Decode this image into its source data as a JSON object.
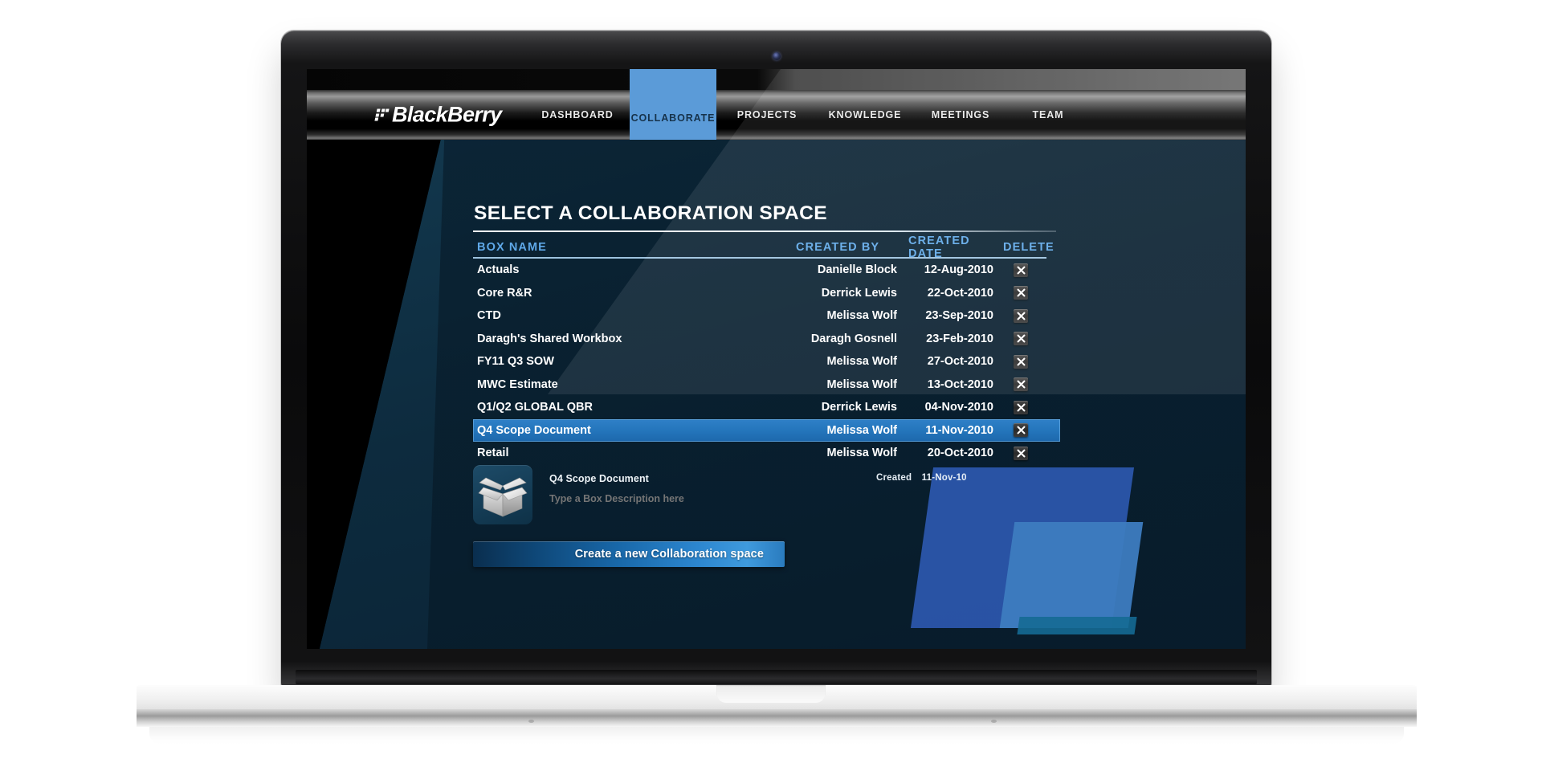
{
  "brand": {
    "name": "BlackBerry"
  },
  "nav": {
    "items": [
      {
        "label": "DASHBOARD",
        "active": false
      },
      {
        "label": "COLLABORATE",
        "active": true
      },
      {
        "label": "PROJECTS",
        "active": false
      },
      {
        "label": "KNOWLEDGE",
        "active": false
      },
      {
        "label": "MEETINGS",
        "active": false
      },
      {
        "label": "TEAM",
        "active": false
      }
    ]
  },
  "page": {
    "title": "SELECT A COLLABORATION SPACE"
  },
  "table": {
    "columns": [
      "BOX NAME",
      "CREATED BY",
      "CREATED DATE",
      "DELETE"
    ],
    "rows": [
      {
        "name": "Actuals",
        "created_by": "Danielle Block",
        "created_date": "12-Aug-2010",
        "selected": false
      },
      {
        "name": "Core R&R",
        "created_by": "Derrick Lewis",
        "created_date": "22-Oct-2010",
        "selected": false
      },
      {
        "name": "CTD",
        "created_by": "Melissa Wolf",
        "created_date": "23-Sep-2010",
        "selected": false
      },
      {
        "name": "Daragh's Shared Workbox",
        "created_by": "Daragh Gosnell",
        "created_date": "23-Feb-2010",
        "selected": false
      },
      {
        "name": "FY11 Q3 SOW",
        "created_by": "Melissa Wolf",
        "created_date": "27-Oct-2010",
        "selected": false
      },
      {
        "name": "MWC Estimate",
        "created_by": "Melissa Wolf",
        "created_date": "13-Oct-2010",
        "selected": false
      },
      {
        "name": "Q1/Q2 GLOBAL QBR",
        "created_by": "Derrick Lewis",
        "created_date": "04-Nov-2010",
        "selected": false
      },
      {
        "name": "Q4 Scope Document",
        "created_by": "Melissa Wolf",
        "created_date": "11-Nov-2010",
        "selected": true
      },
      {
        "name": "Retail",
        "created_by": "Melissa Wolf",
        "created_date": "20-Oct-2010",
        "selected": false
      }
    ],
    "delete_icon": "close-x-icon"
  },
  "detail": {
    "icon": "open-box-icon",
    "name": "Q4 Scope Document",
    "description_placeholder": "Type a Box Description here",
    "created_label": "Created",
    "created_value": "11-Nov-10"
  },
  "actions": {
    "create_space_label": "Create a new Collaboration space"
  },
  "colors": {
    "accent_blue": "#5b9bd8",
    "header_blue": "#5fa8e8",
    "selected_row": "#2475bb",
    "page_bg": "#0d2b3e",
    "deco_blue_dark": "#2a55a8",
    "deco_blue_light": "#3d7cc0"
  }
}
